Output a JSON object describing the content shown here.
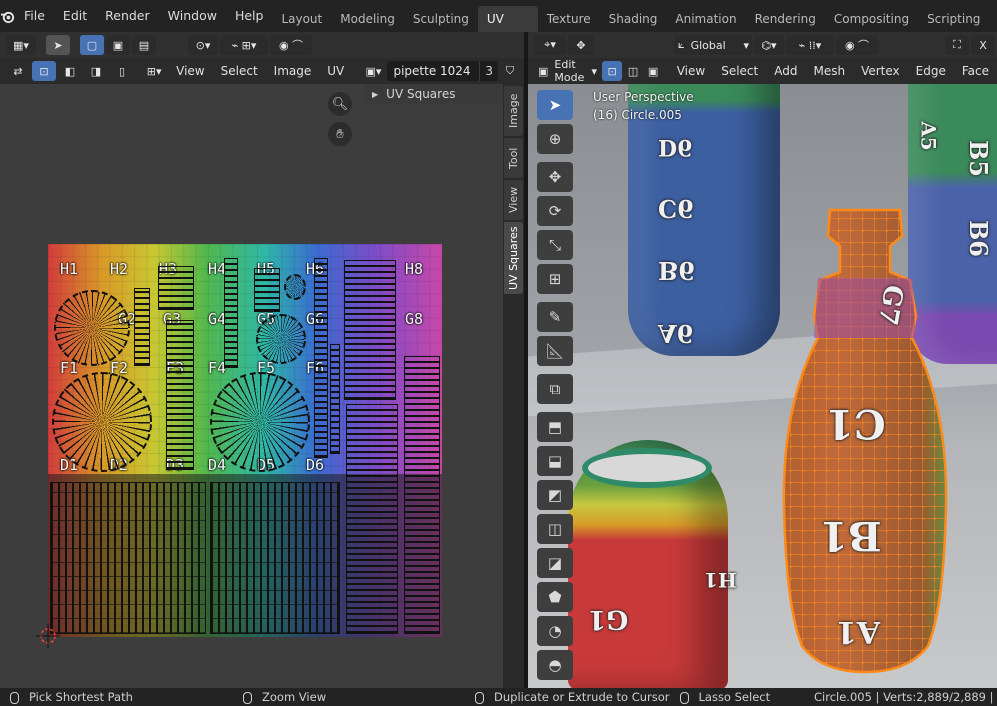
{
  "topbar": {
    "menus": [
      "File",
      "Edit",
      "Render",
      "Window",
      "Help"
    ],
    "workspaces": [
      "Layout",
      "Modeling",
      "Sculpting",
      "UV Editing",
      "Texture Paint",
      "Shading",
      "Animation",
      "Rendering",
      "Compositing",
      "Scripting"
    ],
    "active_workspace": "UV Editing",
    "add_symbol": "+",
    "close_x": "X"
  },
  "uv_editor": {
    "menus": [
      "View",
      "Select",
      "Image",
      "UV"
    ],
    "image_name": "pipette 1024",
    "user_count": "3",
    "panel_title": "UV Squares",
    "side_tabs": [
      "Image",
      "Tool",
      "View",
      "UV Squares"
    ],
    "texture_labels": [
      "H1",
      "H2",
      "H3",
      "H4",
      "H5",
      "H6",
      "H8",
      "G2",
      "G3",
      "G4",
      "G5",
      "G6",
      "G8",
      "F1",
      "F2",
      "F3",
      "F4",
      "F5",
      "F6",
      "D1",
      "D2",
      "D3",
      "D4",
      "D5",
      "D6"
    ]
  },
  "viewport": {
    "transform_orientation": "Global",
    "mode": "Edit Mode",
    "menus": [
      "View",
      "Select",
      "Add",
      "Mesh",
      "Vertex",
      "Edge",
      "Face"
    ],
    "view_name": "User Perspective",
    "object_info": "(16) Circle.005",
    "bottle_labels": {
      "back_left": [
        "D6",
        "C6",
        "B6",
        "A6"
      ],
      "back_right": [
        "B5",
        "B6",
        "A5"
      ],
      "main": [
        "G7",
        "C1",
        "B1",
        "A1"
      ],
      "bowl": [
        "G1",
        "H1"
      ]
    }
  },
  "statusbar": {
    "left_action": "Pick Shortest Path",
    "middle_action": "Zoom View",
    "right_action": "Duplicate or Extrude to Cursor",
    "far_action": "Lasso Select",
    "stats": "Circle.005 | Verts:2,889/2,889 | Edg"
  },
  "colors": {
    "accent": "#4772b3",
    "selection": "#ff8a1a"
  }
}
